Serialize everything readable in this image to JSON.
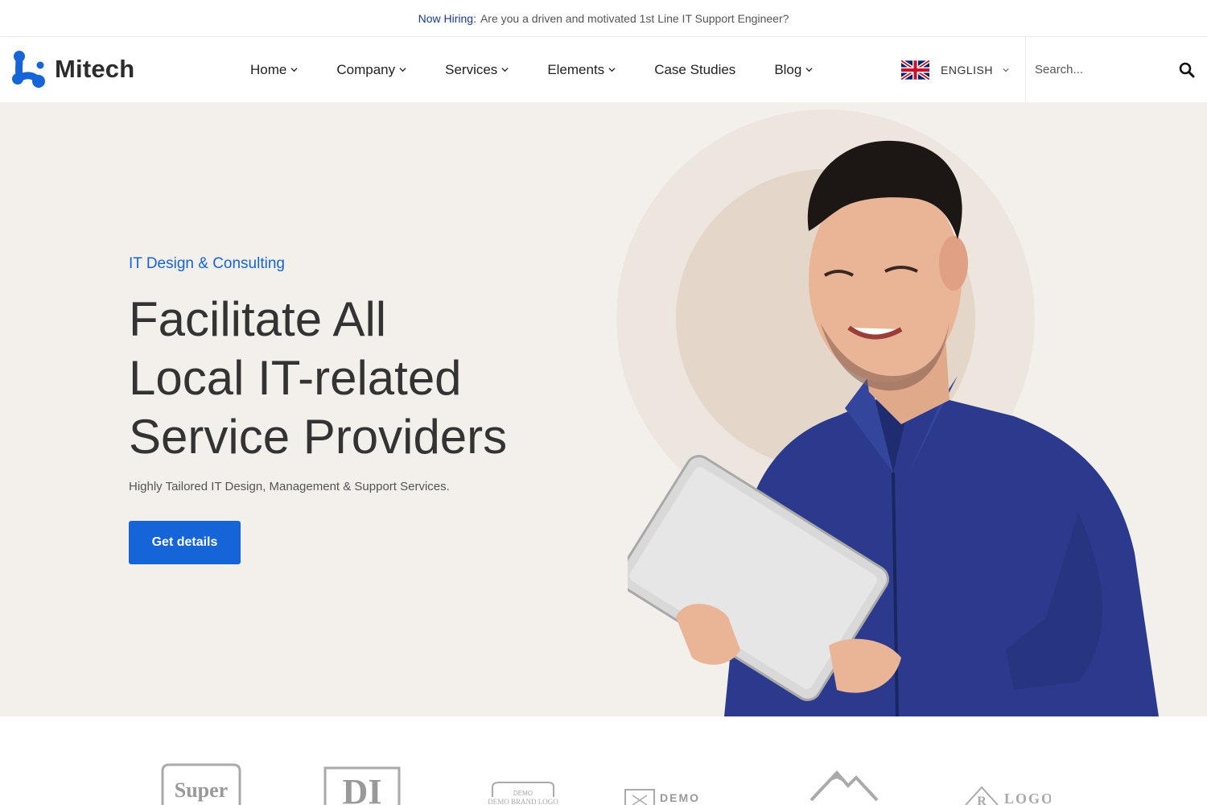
{
  "topbar": {
    "highlight": "Now Hiring:",
    "message": "Are you a driven and motivated 1st Line IT Support Engineer?"
  },
  "header": {
    "logo_text": "Mitech",
    "nav": [
      {
        "label": "Home",
        "has_dropdown": true
      },
      {
        "label": "Company",
        "has_dropdown": true
      },
      {
        "label": "Services",
        "has_dropdown": true
      },
      {
        "label": "Elements",
        "has_dropdown": true
      },
      {
        "label": "Case Studies",
        "has_dropdown": false
      },
      {
        "label": "Blog",
        "has_dropdown": true
      }
    ],
    "language": "ENGLISH",
    "search_placeholder": "Search..."
  },
  "hero": {
    "eyebrow": "IT Design & Consulting",
    "headline": [
      "Facilitate All",
      "Local IT-related",
      "Service Providers"
    ],
    "subtext": "Highly Tailored IT Design, Management & Support Services.",
    "cta_label": "Get details"
  },
  "brands": {
    "logo_1": "Super",
    "logo_2": "DI",
    "logo_3_top": "DEMO",
    "logo_3_bottom": "DEMO BRAND LOGO",
    "logo_4": "DEMO",
    "logo_6": "LOGO"
  },
  "colors": {
    "accent": "#1565d8",
    "hero_bg": "#f3efea",
    "topbar_highlight": "#1a3a8f",
    "shirt": "#2b3a8c"
  }
}
